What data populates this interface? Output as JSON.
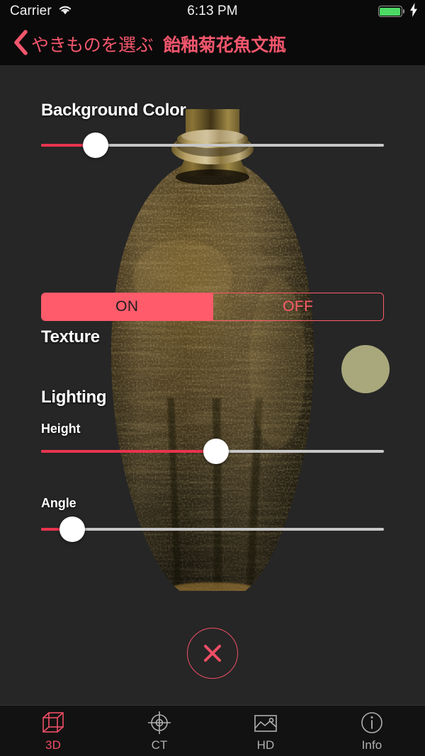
{
  "status_bar": {
    "carrier": "Carrier",
    "wifi_icon": "wifi-icon",
    "time": "6:13 PM",
    "battery_icon": "battery-full-icon",
    "charging_icon": "lightning-bolt-icon"
  },
  "nav": {
    "back_icon": "chevron-left-icon",
    "back_label": "やきものを選ぶ",
    "title": "飴釉菊花魚文瓶"
  },
  "controls": {
    "background_color": {
      "title": "Background Color",
      "slider_value_pct": 16,
      "swatch_color": "#a8a87c"
    },
    "texture": {
      "title": "Texture",
      "options": [
        "ON",
        "OFF"
      ],
      "selected": "ON"
    },
    "lighting": {
      "title": "Lighting",
      "height": {
        "label": "Height",
        "slider_value_pct": 51
      },
      "angle": {
        "label": "Angle",
        "slider_value_pct": 9
      }
    },
    "close_button": {
      "icon": "close-x-icon",
      "color": "#ef4e66"
    }
  },
  "tab_bar": {
    "active": "3D",
    "tabs": [
      {
        "label": "3D",
        "icon": "cube-wireframe-icon"
      },
      {
        "label": "CT",
        "icon": "crosshair-icon"
      },
      {
        "label": "HD",
        "icon": "photo-icon"
      },
      {
        "label": "Info",
        "icon": "info-circle-icon"
      }
    ]
  },
  "theme": {
    "accent": "#ef4e66",
    "segment_accent": "#ff5b6b",
    "background": "#262626",
    "bar_background": "#0a0a0a"
  }
}
